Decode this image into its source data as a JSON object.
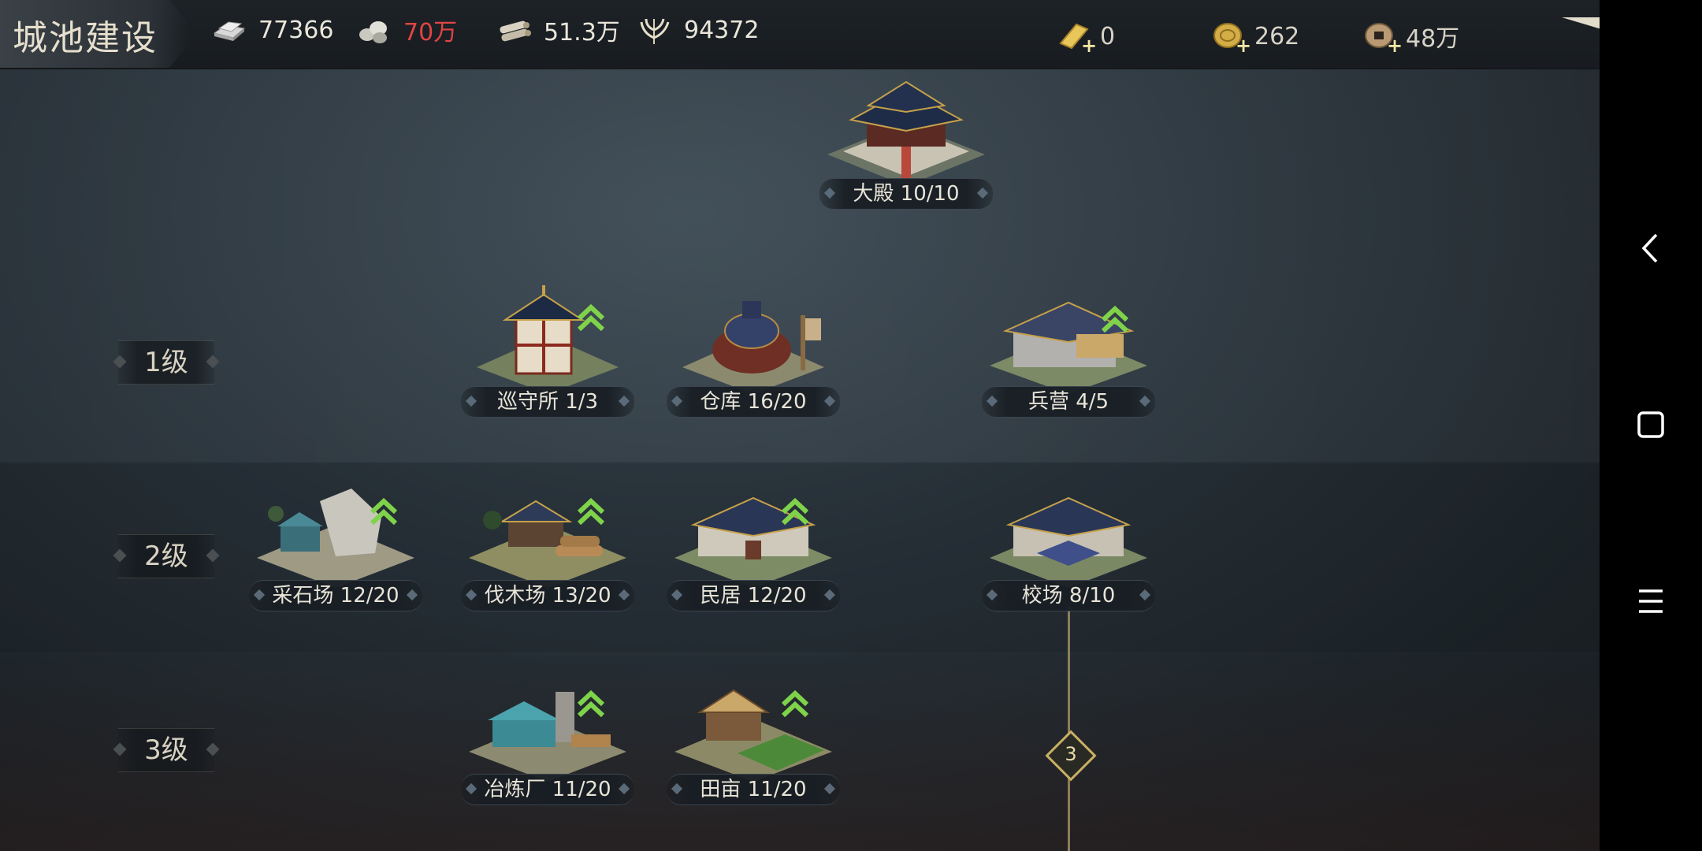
{
  "header": {
    "title": "城池建设",
    "resources": [
      {
        "name": "iron-ingot-icon",
        "value": "77366",
        "alert": false
      },
      {
        "name": "stone-icon",
        "value": "70万",
        "alert": true
      },
      {
        "name": "timber-icon",
        "value": "51.3万",
        "alert": false
      },
      {
        "name": "grain-icon",
        "value": "94372",
        "alert": false
      }
    ],
    "currencies": [
      {
        "name": "gold-bar-icon",
        "value": "0"
      },
      {
        "name": "gold-coin-icon",
        "value": "262"
      },
      {
        "name": "copper-coin-icon",
        "value": "48万"
      }
    ],
    "back_icon": "return-arrow-icon"
  },
  "palace": {
    "label": "大殿 10/10",
    "upgradable": false
  },
  "tiers": [
    {
      "label": "1级",
      "buildings": [
        {
          "label": "巡守所 1/3",
          "upgradable": true
        },
        {
          "label": "仓库 16/20",
          "upgradable": false
        },
        {
          "label": "兵营 4/5",
          "upgradable": true
        }
      ]
    },
    {
      "label": "2级",
      "buildings": [
        {
          "label": "采石场 12/20",
          "upgradable": true
        },
        {
          "label": "伐木场 13/20",
          "upgradable": true
        },
        {
          "label": "民居 12/20",
          "upgradable": true
        },
        {
          "label": "校场 8/10",
          "upgradable": false
        }
      ]
    },
    {
      "label": "3级",
      "buildings": [
        {
          "label": "冶炼厂 11/20",
          "upgradable": true
        },
        {
          "label": "田亩 11/20",
          "upgradable": true
        }
      ]
    }
  ],
  "connector": {
    "badge": "3"
  },
  "android_nav": [
    "back-icon",
    "home-icon",
    "menu-icon"
  ],
  "colors": {
    "upgrade_arrow": "#7fd34a",
    "alert_text": "#e04444",
    "gold": "#c9b064"
  }
}
